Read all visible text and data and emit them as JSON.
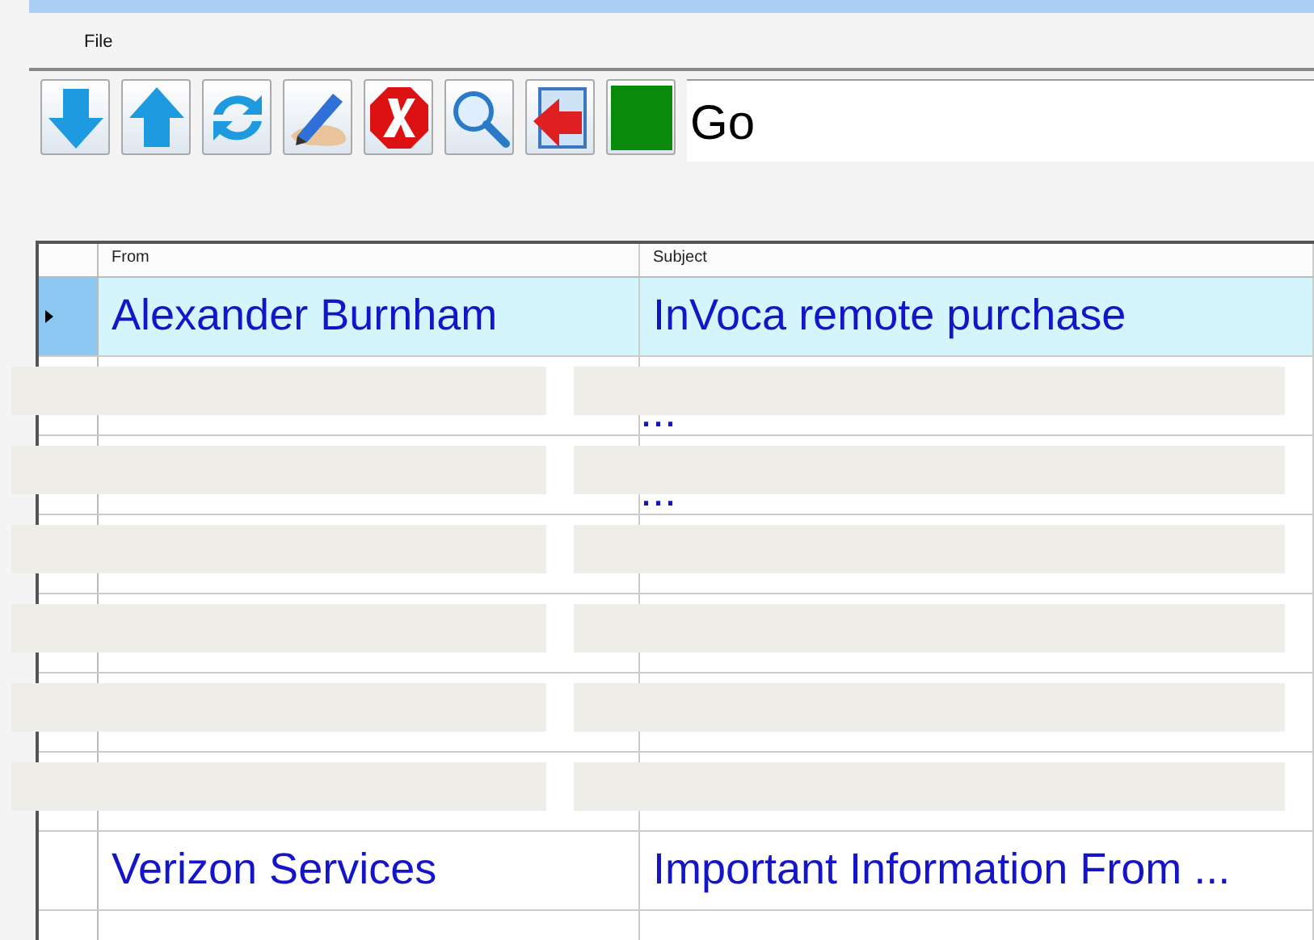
{
  "menu": [
    "File"
  ],
  "toolbar": [
    {
      "kind": "down"
    },
    {
      "kind": "up"
    },
    {
      "kind": "refresh"
    },
    {
      "kind": "pen"
    },
    {
      "kind": "delete"
    },
    {
      "kind": "search"
    },
    {
      "kind": "exit"
    },
    {
      "kind": "green"
    }
  ],
  "go_field": {
    "value": "Go"
  },
  "table": {
    "columns": [
      "From",
      "Subject"
    ],
    "rows": [
      {
        "from": "Alexander Burnham",
        "subject": "InVoca remote purchase",
        "selected": true,
        "redacted": false
      },
      {
        "from": "",
        "subject": "...",
        "selected": false,
        "redacted": true
      },
      {
        "from": "",
        "subject": "...",
        "selected": false,
        "redacted": true
      },
      {
        "from": "",
        "subject": "",
        "selected": false,
        "redacted": true
      },
      {
        "from": "",
        "subject": "",
        "selected": false,
        "redacted": true
      },
      {
        "from": "",
        "subject": "",
        "selected": false,
        "redacted": true
      },
      {
        "from": "",
        "subject": "",
        "selected": false,
        "redacted": true
      },
      {
        "from": "Verizon Services",
        "subject": "Important Information From ...",
        "selected": false,
        "redacted": false
      }
    ]
  }
}
